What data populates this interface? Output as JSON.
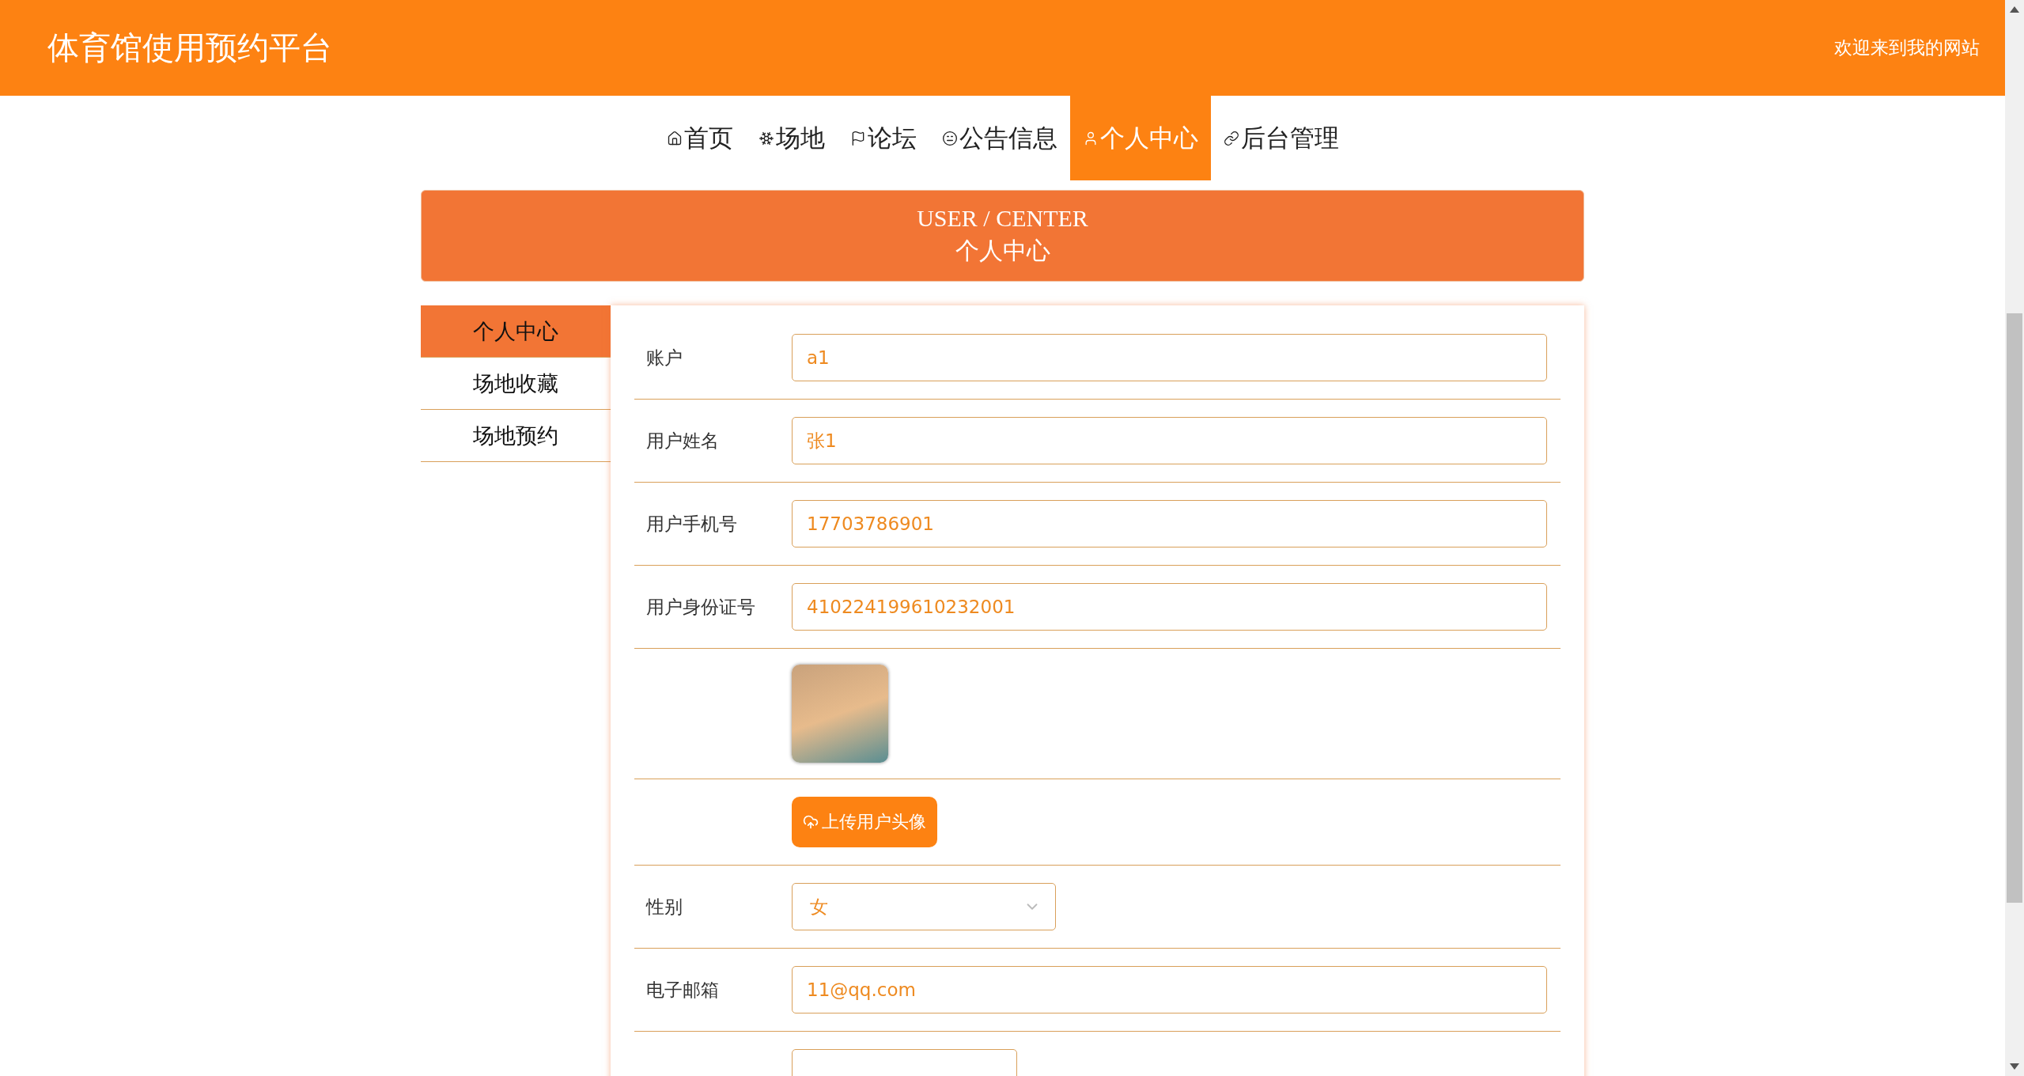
{
  "header": {
    "title": "体育馆使用预约平台",
    "welcome": "欢迎来到我的网站"
  },
  "nav": [
    {
      "label": "首页",
      "selected": false
    },
    {
      "label": "场地",
      "selected": false
    },
    {
      "label": "论坛",
      "selected": false
    },
    {
      "label": "公告信息",
      "selected": false
    },
    {
      "label": "个人中心",
      "selected": true
    },
    {
      "label": "后台管理",
      "selected": false
    }
  ],
  "banner": {
    "title": "USER / CENTER",
    "subtitle": "个人中心"
  },
  "sidebar": [
    {
      "label": "个人中心",
      "selected": true
    },
    {
      "label": "场地收藏",
      "selected": false
    },
    {
      "label": "场地预约",
      "selected": false
    }
  ],
  "form": {
    "fields": [
      {
        "kind": "text",
        "label": "账户",
        "value": "a1"
      },
      {
        "kind": "text",
        "label": "用户姓名",
        "value": "张1"
      },
      {
        "kind": "text",
        "label": "用户手机号",
        "value": "17703786901"
      },
      {
        "kind": "text",
        "label": "用户身份证号",
        "value": "410224199610232001"
      },
      {
        "kind": "avatar"
      },
      {
        "kind": "upload",
        "button": "上传用户头像"
      },
      {
        "kind": "select",
        "label": "性别",
        "value": "女"
      },
      {
        "kind": "text",
        "label": "电子邮箱",
        "value": "11@qq.com"
      },
      {
        "kind": "cutoff"
      }
    ]
  }
}
